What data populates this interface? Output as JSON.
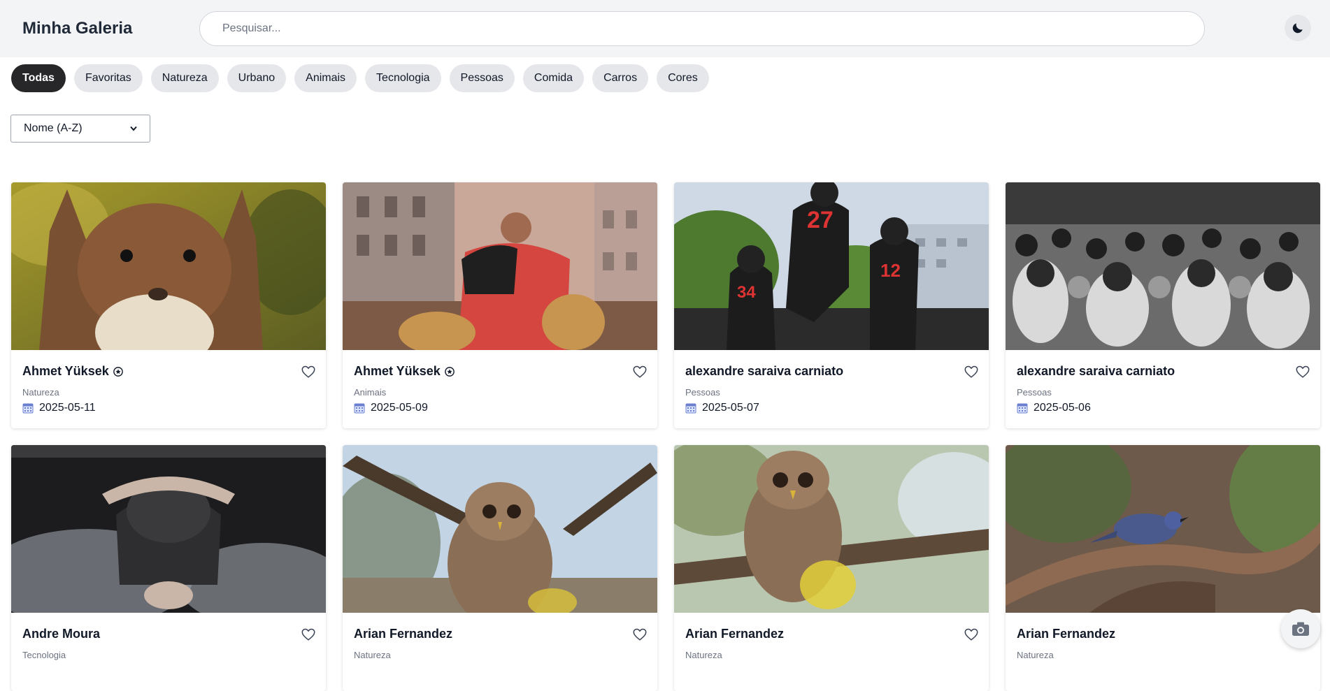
{
  "header": {
    "title": "Minha Galeria",
    "search_placeholder": "Pesquisar...",
    "theme_icon": "moon-icon"
  },
  "filters": [
    {
      "label": "Todas",
      "active": true
    },
    {
      "label": "Favoritas",
      "active": false
    },
    {
      "label": "Natureza",
      "active": false
    },
    {
      "label": "Urbano",
      "active": false
    },
    {
      "label": "Animais",
      "active": false
    },
    {
      "label": "Tecnologia",
      "active": false
    },
    {
      "label": "Pessoas",
      "active": false
    },
    {
      "label": "Comida",
      "active": false
    },
    {
      "label": "Carros",
      "active": false
    },
    {
      "label": "Cores",
      "active": false
    }
  ],
  "sort": {
    "selected": "Nome (A-Z)"
  },
  "cards": [
    {
      "author": "Ahmet Yüksek",
      "verified": true,
      "category": "Natureza",
      "date": "2025-05-11",
      "photo": "squirrel"
    },
    {
      "author": "Ahmet Yüksek",
      "verified": true,
      "category": "Animais",
      "date": "2025-05-09",
      "photo": "man-with-dogs"
    },
    {
      "author": "alexandre saraiva carniato",
      "verified": false,
      "category": "Pessoas",
      "date": "2025-05-07",
      "photo": "football-players"
    },
    {
      "author": "alexandre saraiva carniato",
      "verified": false,
      "category": "Pessoas",
      "date": "2025-05-06",
      "photo": "crowd-bw"
    },
    {
      "author": "Andre Moura",
      "verified": false,
      "category": "Tecnologia",
      "date": "",
      "photo": "person-smoke"
    },
    {
      "author": "Arian Fernandez",
      "verified": false,
      "category": "Natureza",
      "date": "",
      "photo": "owl-1"
    },
    {
      "author": "Arian Fernandez",
      "verified": false,
      "category": "Natureza",
      "date": "",
      "photo": "owl-2"
    },
    {
      "author": "Arian Fernandez",
      "verified": false,
      "category": "Natureza",
      "date": "",
      "photo": "blue-bird"
    }
  ],
  "icons": {
    "favorite": "heart-icon",
    "date": "calendar-icon",
    "verified": "verified-badge-icon",
    "fab": "camera-icon"
  }
}
